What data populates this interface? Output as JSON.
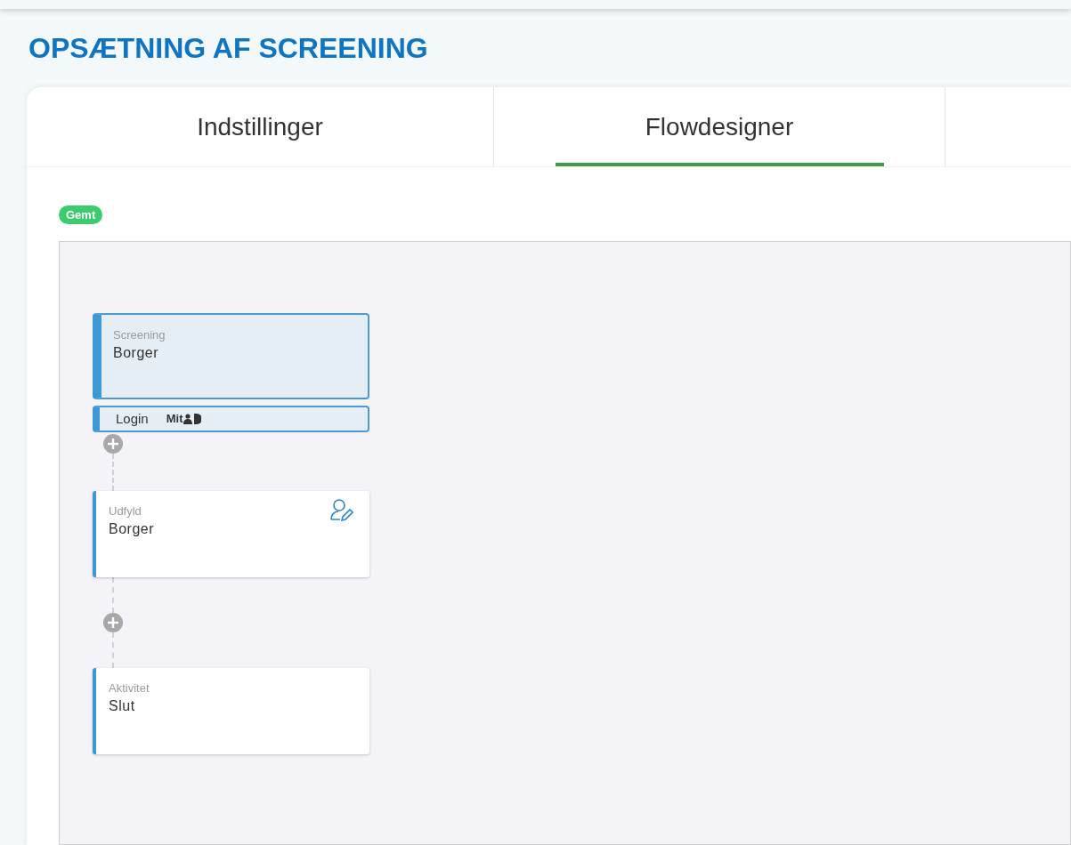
{
  "title": "OPSÆTNING AF SCREENING",
  "tabs": [
    {
      "label": "Indstillinger",
      "selected": false
    },
    {
      "label": "Flowdesigner",
      "selected": true
    }
  ],
  "status_badge": "Gemt",
  "nodes": [
    {
      "kind": "start",
      "type_label": "Screening",
      "name": "Borger",
      "selected": true,
      "login": {
        "label": "Login",
        "provider": "Mit"
      }
    },
    {
      "kind": "form",
      "type_label": "Udfyld",
      "name": "Borger",
      "selected": false
    },
    {
      "kind": "end",
      "type_label": "Aktivitet",
      "name": "Slut",
      "selected": false
    }
  ]
}
